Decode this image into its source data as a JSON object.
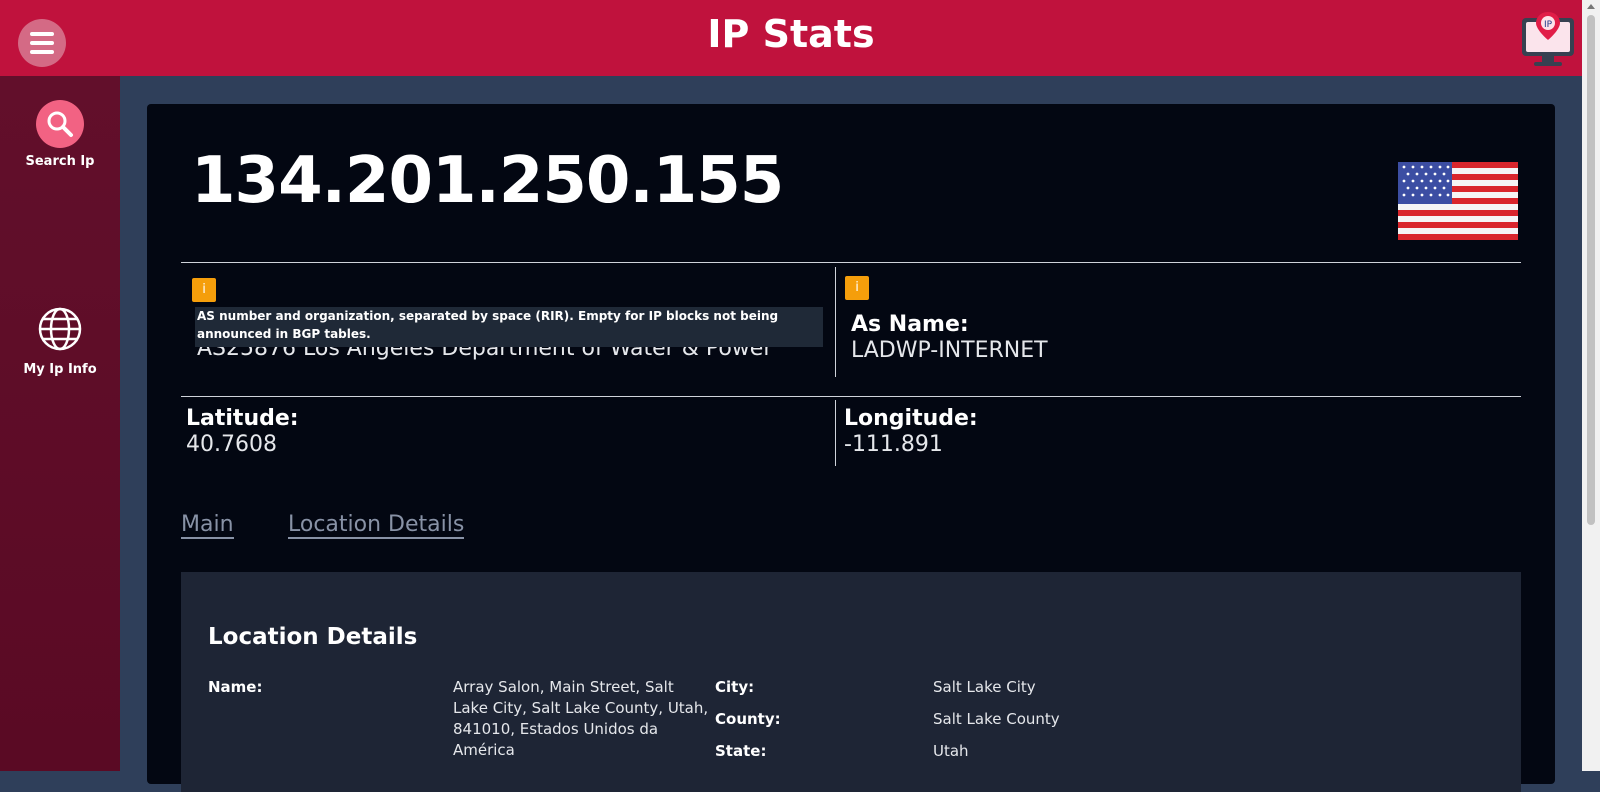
{
  "header": {
    "title": "IP Stats",
    "logo_text": "IP"
  },
  "sidebar": {
    "items": [
      {
        "label": "Search Ip",
        "icon": "search-icon"
      },
      {
        "label": "My Ip Info",
        "icon": "globe-icon"
      }
    ]
  },
  "ip": {
    "address": "134.201.250.155",
    "country_flag": "us-flag"
  },
  "as_info": {
    "badge": "i",
    "tooltip": "AS number and organization, separated by space (RIR). Empty for IP blocks not being announced in BGP tables.",
    "value": "AS25876 Los Angeles Department of Water & Power"
  },
  "as_name": {
    "badge": "i",
    "label": "As Name:",
    "value": "LADWP-INTERNET"
  },
  "latitude": {
    "label": "Latitude:",
    "value": "40.7608"
  },
  "longitude": {
    "label": "Longitude:",
    "value": "-111.891"
  },
  "tabs": [
    {
      "label": "Main"
    },
    {
      "label": "Location Details"
    }
  ],
  "location": {
    "title": "Location Details",
    "name_label": "Name:",
    "name_value_lines": [
      "Array Salon, Main Street, Salt",
      "Lake City, Salt Lake County, Utah,",
      "841010, Estados Unidos da",
      "América"
    ],
    "city_label": "City:",
    "city_value": "Salt Lake City",
    "county_label": "County:",
    "county_value": "Salt Lake County",
    "state_label": "State:",
    "state_value": "Utah"
  },
  "colors": {
    "header": "#c0123d",
    "sidebar": "#5a0a24",
    "card": "#030712",
    "badge": "#f59e0b",
    "search_button": "#f26283"
  }
}
